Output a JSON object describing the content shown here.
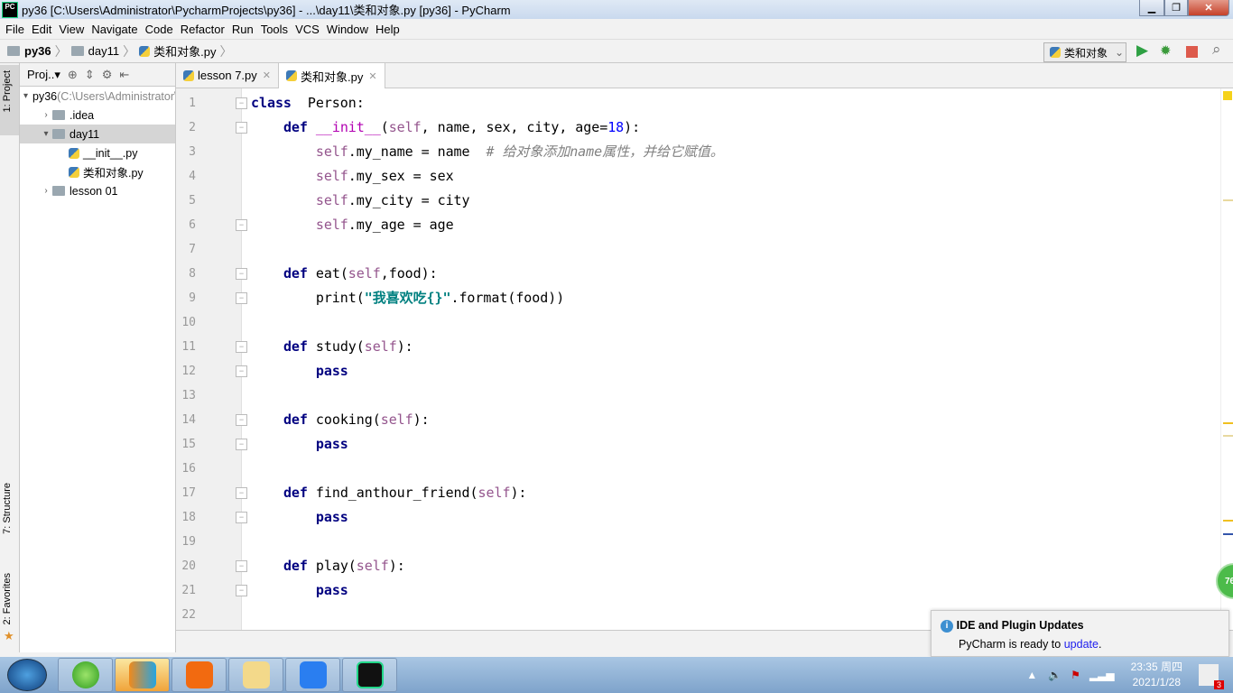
{
  "window": {
    "title": "py36 [C:\\Users\\Administrator\\PycharmProjects\\py36] - ...\\day11\\类和对象.py [py36] - PyCharm",
    "logo": "PC"
  },
  "menu": [
    "File",
    "Edit",
    "View",
    "Navigate",
    "Code",
    "Refactor",
    "Run",
    "Tools",
    "VCS",
    "Window",
    "Help"
  ],
  "breadcrumb": [
    "py36",
    "day11",
    "类和对象.py"
  ],
  "run_config": "类和对象",
  "side_tabs": {
    "project": "1: Project",
    "structure": "7: Structure",
    "favorites": "2: Favorites"
  },
  "project_panel": {
    "title": "Proj..▾",
    "tree": [
      {
        "label": "py36",
        "extra": " (C:\\Users\\Administrator\\PycharmProjects\\py36)",
        "indent": 0,
        "arrow": "▾",
        "type": "folder"
      },
      {
        "label": ".idea",
        "indent": 1,
        "arrow": "›",
        "type": "folder"
      },
      {
        "label": "day11",
        "indent": 1,
        "arrow": "▾",
        "type": "folder",
        "selected": true
      },
      {
        "label": "__init__.py",
        "indent": 2,
        "arrow": "",
        "type": "py"
      },
      {
        "label": "类和对象.py",
        "indent": 2,
        "arrow": "",
        "type": "py"
      },
      {
        "label": "lesson 01",
        "indent": 1,
        "arrow": "›",
        "type": "folder"
      }
    ]
  },
  "tabs": [
    {
      "label": "lesson 7.py",
      "active": false
    },
    {
      "label": "类和对象.py",
      "active": true
    }
  ],
  "code": [
    [
      [
        "kw",
        "class"
      ],
      [
        "",
        "  Person:"
      ]
    ],
    [
      [
        "",
        "    "
      ],
      [
        "kw",
        "def"
      ],
      [
        "",
        ""
      ],
      [
        "magic",
        " __init__"
      ],
      [
        "",
        "("
      ],
      [
        "self",
        "self"
      ],
      [
        "",
        ", name, sex, city, age="
      ],
      [
        "num",
        "18"
      ],
      [
        "",
        "):"
      ]
    ],
    [
      [
        "",
        "        "
      ],
      [
        "self",
        "self"
      ],
      [
        "",
        ".my_name = name  "
      ],
      [
        "cmt",
        "# 给对象添加name属性，并给它赋值。"
      ]
    ],
    [
      [
        "",
        "        "
      ],
      [
        "self",
        "self"
      ],
      [
        "",
        ".my_sex = sex"
      ]
    ],
    [
      [
        "",
        "        "
      ],
      [
        "self",
        "self"
      ],
      [
        "",
        ".my_city = city"
      ]
    ],
    [
      [
        "",
        "        "
      ],
      [
        "self",
        "self"
      ],
      [
        "",
        ".my_age = age"
      ]
    ],
    [],
    [
      [
        "",
        "    "
      ],
      [
        "kw",
        "def"
      ],
      [
        "",
        " eat("
      ],
      [
        "self",
        "self"
      ],
      [
        "",
        ",food):"
      ]
    ],
    [
      [
        "",
        "        print("
      ],
      [
        "str",
        "\"我喜欢吃{}\""
      ],
      [
        "",
        ".format(food))"
      ]
    ],
    [],
    [
      [
        "",
        "    "
      ],
      [
        "kw",
        "def"
      ],
      [
        "",
        " study("
      ],
      [
        "self",
        "self"
      ],
      [
        "",
        "):"
      ]
    ],
    [
      [
        "",
        "        "
      ],
      [
        "kw",
        "pass"
      ]
    ],
    [],
    [
      [
        "",
        "    "
      ],
      [
        "kw",
        "def"
      ],
      [
        "",
        " cooking("
      ],
      [
        "self",
        "self"
      ],
      [
        "",
        "):"
      ]
    ],
    [
      [
        "",
        "        "
      ],
      [
        "kw",
        "pass"
      ]
    ],
    [],
    [
      [
        "",
        "    "
      ],
      [
        "kw",
        "def"
      ],
      [
        "",
        " find_anthour_friend("
      ],
      [
        "self",
        "self"
      ],
      [
        "",
        "):"
      ]
    ],
    [
      [
        "",
        "        "
      ],
      [
        "kw",
        "pass"
      ]
    ],
    [],
    [
      [
        "",
        "    "
      ],
      [
        "kw",
        "def"
      ],
      [
        "",
        " play("
      ],
      [
        "self",
        "self"
      ],
      [
        "",
        "):"
      ]
    ],
    [
      [
        "",
        "        "
      ],
      [
        "kw",
        "pass"
      ]
    ],
    []
  ],
  "folds": [
    1,
    2,
    6,
    8,
    9,
    11,
    12,
    14,
    15,
    17,
    18,
    20,
    21
  ],
  "inspection_badge": "76",
  "notification": {
    "title": "IDE and Plugin Updates",
    "text": "PyCharm is ready to ",
    "link": "update",
    "end": "."
  },
  "tray": {
    "time": "23:35 周四",
    "date": "2021/1/28",
    "badge": "3"
  }
}
